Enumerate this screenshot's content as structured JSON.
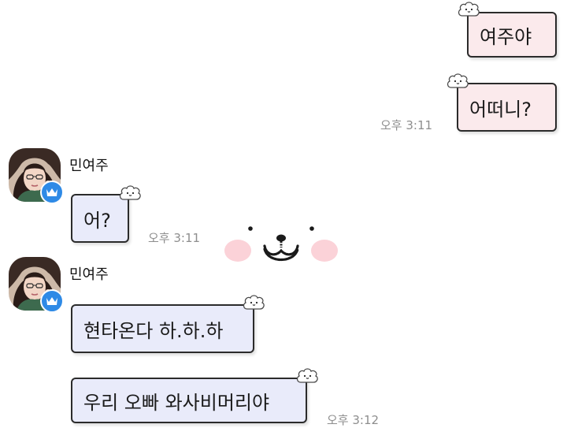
{
  "messages": [
    {
      "text": "여주야"
    },
    {
      "text": "어떠니?",
      "time": "오후 3:11"
    },
    {
      "sender": "민여주",
      "text": "어?",
      "time": "오후 3:11"
    },
    {
      "sender": "민여주",
      "text": "현타온다 하.하.하"
    },
    {
      "text": "우리 오빠 와사비머리야",
      "time": "오후 3:12"
    }
  ],
  "colors": {
    "my_bubble": "#fbeaec",
    "their_bubble": "#e9ebfa",
    "bubble_border": "#2b2b2b",
    "timestamp": "#8e8e8e",
    "badge": "#2e8ae6"
  },
  "icons": {
    "bubble_decoration": "cloud-face-icon",
    "avatar_badge": "crown-icon",
    "sticker": "bear-face-sticker"
  }
}
